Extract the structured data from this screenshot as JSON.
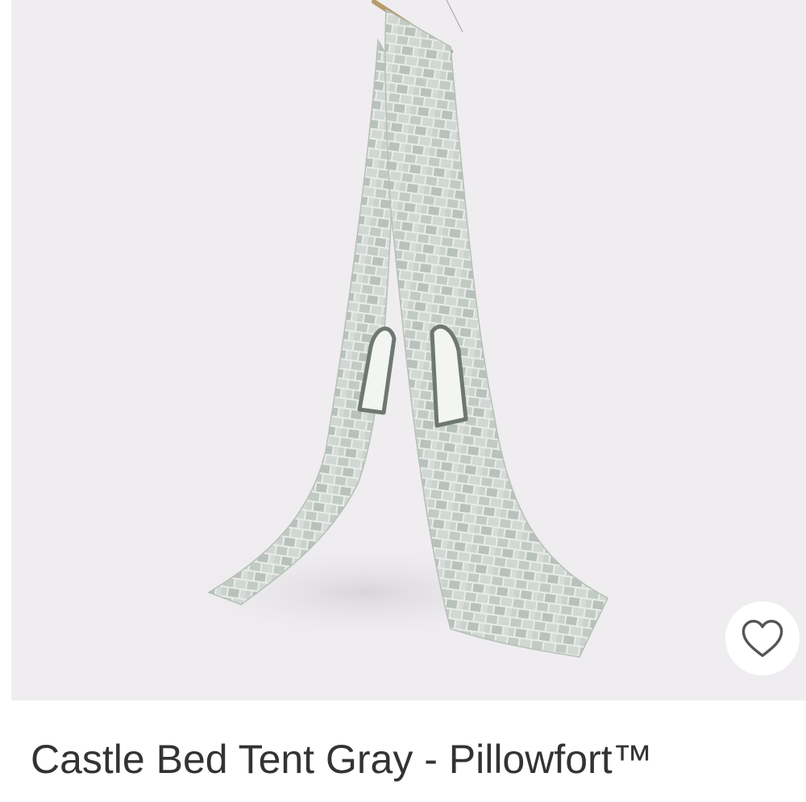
{
  "product": {
    "title": "Castle Bed Tent Gray - Pillowfort™",
    "image_alt": "Castle Bed Tent Gray",
    "favorite": {
      "icon": "heart-outline-icon",
      "selected": false
    }
  },
  "colors": {
    "image_background": "#efedf0",
    "title_text": "#333333",
    "fabric": "#e6ebe7",
    "brick": "#b9c2bc",
    "window_frame": "#6f7771",
    "favorite_icon": "#555555"
  }
}
